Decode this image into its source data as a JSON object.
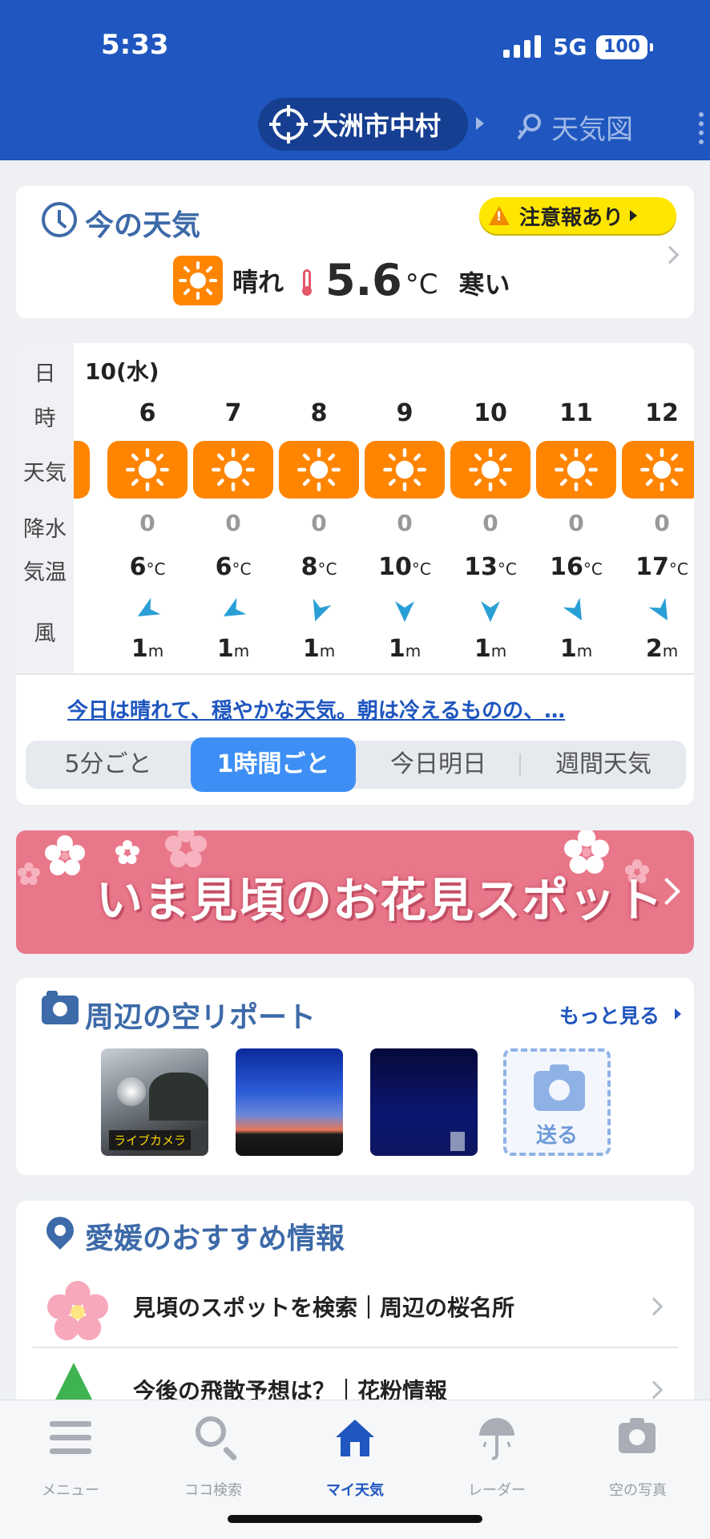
{
  "status_bar": {
    "time": "5:33",
    "network": "5G",
    "battery": "100"
  },
  "header": {
    "location": "大洲市中村",
    "map_link": "天気図"
  },
  "now": {
    "title": "今の天気",
    "alert": "注意報あり",
    "condition": "晴れ",
    "temp": "5.6",
    "temp_unit": "°C",
    "feel": "寒い"
  },
  "hourly": {
    "row_labels": {
      "day": "日",
      "hour": "時",
      "weather": "天気",
      "precip": "降水",
      "temp": "気温",
      "wind": "風"
    },
    "day": "10(水)",
    "temp_unit": "°C",
    "wind_unit": "m",
    "hours": [
      {
        "hour": "6",
        "precip": "0",
        "temp": "6",
        "wind": "1",
        "wind_dir_deg": 60
      },
      {
        "hour": "7",
        "precip": "0",
        "temp": "6",
        "wind": "1",
        "wind_dir_deg": 60
      },
      {
        "hour": "8",
        "precip": "0",
        "temp": "8",
        "wind": "1",
        "wind_dir_deg": 20
      },
      {
        "hour": "9",
        "precip": "0",
        "temp": "10",
        "wind": "1",
        "wind_dir_deg": 0
      },
      {
        "hour": "10",
        "precip": "0",
        "temp": "13",
        "wind": "1",
        "wind_dir_deg": 0
      },
      {
        "hour": "11",
        "precip": "0",
        "temp": "16",
        "wind": "1",
        "wind_dir_deg": -30
      },
      {
        "hour": "12",
        "precip": "0",
        "temp": "17",
        "wind": "2",
        "wind_dir_deg": -30
      }
    ],
    "summary": "今日は晴れて、穏やかな天気。朝は冷えるものの、…",
    "tabs": [
      {
        "label": "5分ごと",
        "active": false
      },
      {
        "label": "1時間ごと",
        "active": true
      },
      {
        "label": "今日明日",
        "active": false
      },
      {
        "label": "週間天気",
        "active": false
      }
    ]
  },
  "banner": {
    "text": "いま見頃のお花見スポット"
  },
  "sky_report": {
    "title": "周辺の空リポート",
    "more": "もっと見る",
    "live_label": "ライブカメラ",
    "send": "送る"
  },
  "recommend": {
    "title": "愛媛のおすすめ情報",
    "items": [
      {
        "label": "見頃のスポットを検索｜周辺の桜名所",
        "icon": "sakura-icon"
      },
      {
        "label": "今後の飛散予想は？｜花粉情報",
        "icon": "tree-icon"
      }
    ]
  },
  "bottom_nav": [
    {
      "label": "メニュー",
      "icon": "menu-icon"
    },
    {
      "label": "ココ検索",
      "icon": "search-icon"
    },
    {
      "label": "マイ天気",
      "icon": "home-icon",
      "active": true
    },
    {
      "label": "レーダー",
      "icon": "radar-icon"
    },
    {
      "label": "空の写真",
      "icon": "camera-icon"
    }
  ],
  "colors": {
    "header_blue": "#1f56bf",
    "sun_orange": "#ff8500",
    "accent_blue": "#3d6aa8",
    "banner_pink": "#e9778a",
    "alert_yellow": "#ffe600"
  }
}
